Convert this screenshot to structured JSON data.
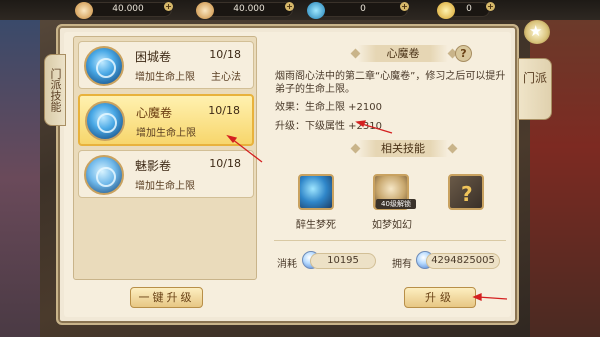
{
  "topbar": {
    "resources": [
      {
        "icon": "scroll-icon",
        "value": "40.000"
      },
      {
        "icon": "scroll-icon",
        "value": "40.000"
      },
      {
        "icon": "jade-icon",
        "value": "0"
      },
      {
        "icon": "coin-icon",
        "value": "0"
      }
    ]
  },
  "tabs": {
    "left": "门派技能",
    "right": "门派"
  },
  "list": {
    "items": [
      {
        "name": "困城卷",
        "level": "10/18",
        "desc": "增加生命上限",
        "type": "主心法",
        "selected": false
      },
      {
        "name": "心魔卷",
        "level": "10/18",
        "desc": "增加生命上限",
        "type": "",
        "selected": true
      },
      {
        "name": "魅影卷",
        "level": "10/18",
        "desc": "增加生命上限",
        "type": "",
        "selected": false
      }
    ],
    "onekey_label": "一键升级"
  },
  "detail": {
    "title": "心魔卷",
    "help": "?",
    "description": "烟雨阁心法中的第二章“心魔卷”，修习之后可以提升弟子的生命上限。",
    "effect": "效果：生命上限  +2100",
    "upgrade": "升级：下级属性  +2310",
    "related_title": "相关技能",
    "skills": [
      {
        "label": "醉生梦死",
        "icon": "skill-swirl-icon"
      },
      {
        "label": "如梦如幻",
        "icon": "skill-locked-icon",
        "tag": "40级解锁"
      },
      {
        "label": "",
        "icon": "unknown-skill-icon"
      }
    ],
    "cost_label": "消耗",
    "cost_value": "10195",
    "own_label": "拥有",
    "own_value": "4294825005",
    "upgrade_label": "升级"
  },
  "colors": {
    "panel_bg": "#f6eedd",
    "selected_bg": "#f7d66c",
    "annotation": "#d42020"
  }
}
